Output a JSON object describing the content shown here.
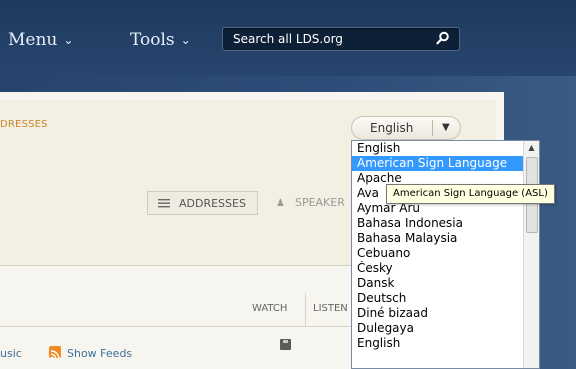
{
  "nav": {
    "menu_label": "Menu",
    "tools_label": "Tools",
    "search_placeholder": "Search all LDS.org"
  },
  "panel": {
    "addresses_link": "DRESSES",
    "language_value": "English",
    "addresses_button": "ADDRESSES",
    "speakers_button": "SPEAKER",
    "table": {
      "watch_header": "WATCH",
      "listen_header": "LISTEN"
    },
    "music_link": "usic",
    "feeds_link": "Show Feeds"
  },
  "dropdown": {
    "options": [
      "English",
      "American Sign Language",
      "Apache",
      "Ava",
      "Aymar Aru",
      "Bahasa Indonesia",
      "Bahasa Malaysia",
      "Cebuano",
      "Česky",
      "Dansk",
      "Deutsch",
      "Diné bizaad",
      "Dulegaya",
      "English"
    ],
    "selected_index": 1,
    "tooltip": "American Sign Language (ASL)"
  },
  "colors": {
    "nav_bg": "#27456d",
    "selection": "#3399ff",
    "link_orange": "#c8862f",
    "link_blue": "#3f6f9c"
  },
  "icons": {
    "search": "magnifier-icon",
    "rss": "rss-icon",
    "list": "list-lines-icon",
    "speaker": "person-icon",
    "save": "floppy-disk-icon"
  }
}
